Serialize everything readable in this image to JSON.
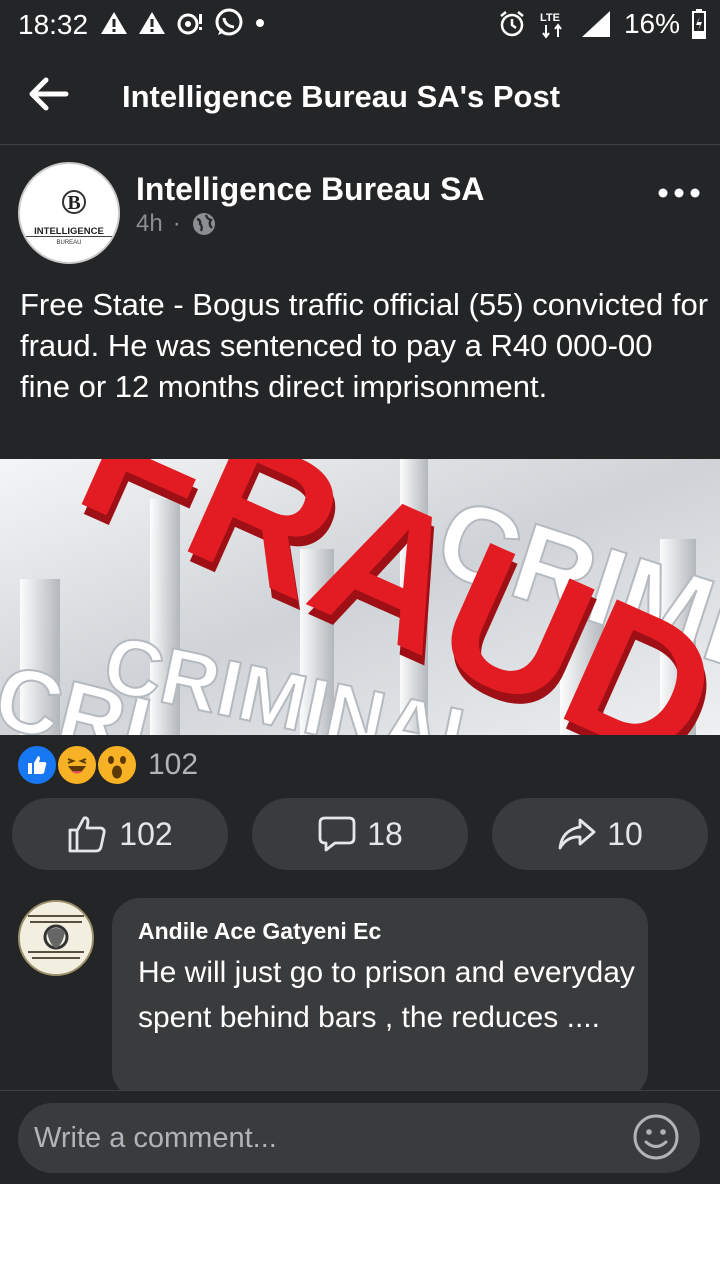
{
  "status_bar": {
    "time": "18:32",
    "battery": "16%",
    "network": "LTE",
    "icons": [
      "warning-icon",
      "warning-icon",
      "notification-icon",
      "whatsapp-icon",
      "dot-icon",
      "alarm-icon",
      "lte-icon",
      "signal-icon",
      "battery-charging-icon"
    ]
  },
  "header": {
    "title": "Intelligence Bureau SA's Post"
  },
  "post": {
    "author": "Intelligence Bureau SA",
    "avatar_text_top": "B",
    "avatar_text_main": "INTELLIGENCE",
    "avatar_text_sub": "BUREAU",
    "time": "4h",
    "separator": "·",
    "text": "Free State - Bogus traffic official (55) convicted for fraud. He was sentenced to pay a R40 000-00 fine or 12 months direct imprisonment.",
    "image": {
      "main_word": "FRAUD",
      "background_words": [
        "CRIME",
        "CRIMINAL",
        "CRI"
      ]
    },
    "reactions": {
      "icons": [
        "like-reaction-icon",
        "haha-reaction-icon",
        "wow-reaction-icon"
      ],
      "count": "102"
    },
    "actions": {
      "like_count": "102",
      "comment_count": "18",
      "share_count": "10"
    }
  },
  "comment": {
    "author": "Andile Ace Gatyeni Ec",
    "text": "He will just go to prison and everyday spent behind bars , the reduces ...."
  },
  "comment_bar": {
    "placeholder": "Write a comment..."
  },
  "colors": {
    "background": "#242526",
    "surface": "#3a3b3c",
    "text": "#e4e6eb",
    "muted": "#b0b3b8",
    "like_blue": "#1877f2",
    "fraud_red": "#e31b23"
  }
}
